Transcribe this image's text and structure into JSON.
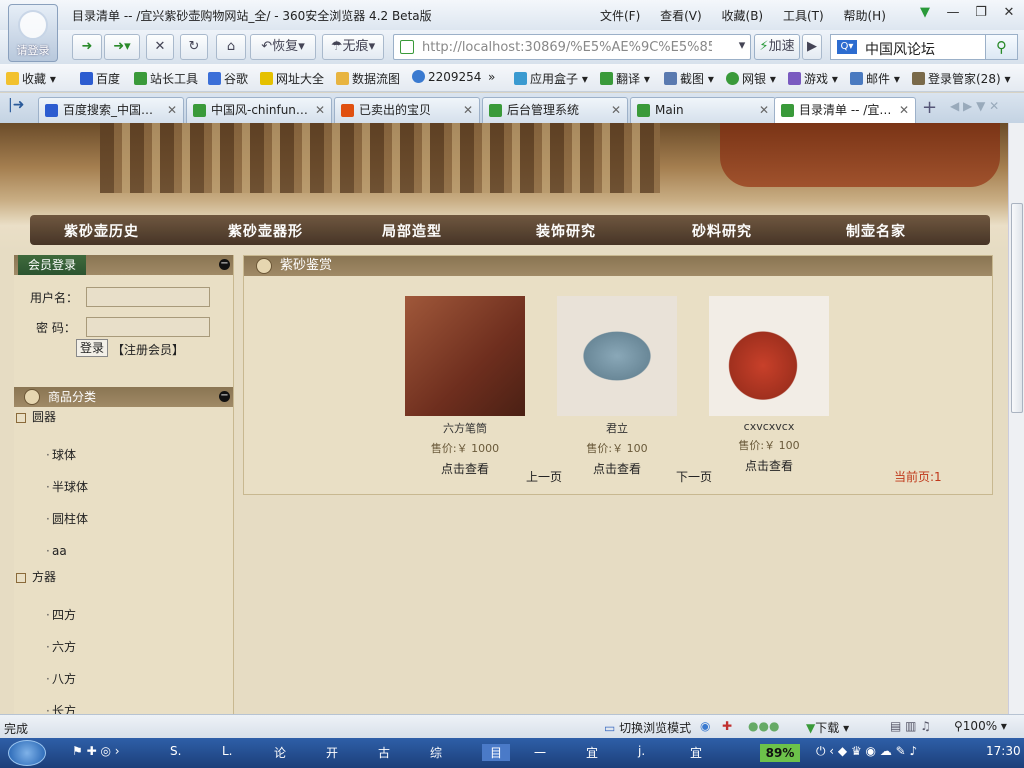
{
  "window": {
    "avatar_label": "请登录",
    "title": "目录清单 -- /宜兴紫砂壶购物网站_全/ - 360安全浏览器 4.2 Beta版",
    "menus": [
      "文件(F)",
      "查看(V)",
      "收藏(B)",
      "工具(T)",
      "帮助(H)"
    ]
  },
  "toolbar": {
    "restore_label": "恢复",
    "notrace_label": "无痕",
    "address": "http://localhost:30869/%E5%AE%9C%E5%85%",
    "accelerate_label": "加速",
    "search_value": "中国风论坛"
  },
  "favbar": {
    "items": [
      "收藏",
      "百度",
      "站长工具",
      "谷歌",
      "网址大全",
      "数据流图",
      "2209254",
      "»",
      "应用盒子",
      "翻译",
      "截图",
      "网银",
      "游戏",
      "邮件",
      "登录管家(28)"
    ]
  },
  "tabs": [
    {
      "label": "百度搜索_中国…",
      "color": "#2c5cd0"
    },
    {
      "label": "中国风-chinfun…",
      "color": "#3a9a3a"
    },
    {
      "label": "已卖出的宝贝",
      "color": "#e05010"
    },
    {
      "label": "后台管理系统",
      "color": "#3a9a3a"
    },
    {
      "label": "Main",
      "color": "#3a9a3a"
    },
    {
      "label": "目录清单 -- /宜…",
      "color": "#3a9a3a"
    }
  ],
  "site": {
    "nav": [
      "紫砂壶历史",
      "紫砂壶器形",
      "局部造型",
      "装饰研究",
      "砂料研究",
      "制壶名家"
    ],
    "login": {
      "header": "会员登录",
      "username_label": "用户名：",
      "password_label": "密  码：",
      "login_button": "登录",
      "register_link": "【注册会员】"
    },
    "categories": {
      "header": "商品分类",
      "items": [
        {
          "label": "圆器",
          "type": "parent"
        },
        {
          "label": "球体",
          "type": "child"
        },
        {
          "label": "半球体",
          "type": "child"
        },
        {
          "label": "圆柱体",
          "type": "child"
        },
        {
          "label": "aa",
          "type": "child"
        },
        {
          "label": "方器",
          "type": "parent"
        },
        {
          "label": "四方",
          "type": "child"
        },
        {
          "label": "六方",
          "type": "child"
        },
        {
          "label": "八方",
          "type": "child"
        },
        {
          "label": "长方",
          "type": "child"
        }
      ]
    },
    "main": {
      "header": "紫砂鉴赏",
      "products": [
        {
          "name": "六方笔筒",
          "price": "售价:￥ 1000",
          "view": "点击查看"
        },
        {
          "name": "君立",
          "price": "售价:￥ 100",
          "view": "点击查看"
        },
        {
          "name": "cxvcxvcx",
          "price": "售价:￥ 100",
          "view": "点击查看"
        }
      ],
      "prev": "上一页",
      "next": "下一页",
      "current": "当前页:1"
    }
  },
  "status": {
    "text": "完成",
    "mode": "切换浏览模式",
    "download": "下载",
    "zoom": "100%"
  },
  "taskbar": {
    "items": [
      "S.",
      "L.",
      "论",
      "开",
      "古",
      "综",
      "目",
      "一",
      "宜",
      "j.",
      "宜"
    ],
    "battery": "89%",
    "time": "17:30"
  }
}
